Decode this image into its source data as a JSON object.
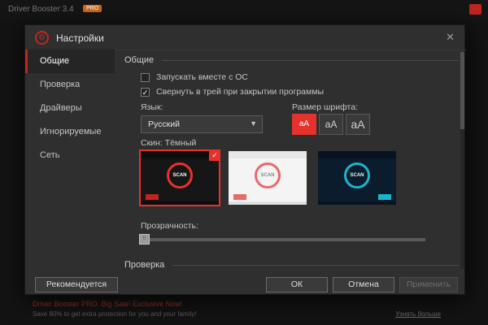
{
  "window": {
    "title": "Driver Booster 3.4",
    "badge": "PRO"
  },
  "background_promo": {
    "line1": "Driver Booster PRO: Big Sale! Exclusive Now!",
    "line2": "Save 80% to get extra protection for you and your family!",
    "link": "Узнать больше"
  },
  "icons": {
    "gear": "⚙",
    "close": "✕",
    "check": "✓",
    "dropdown": "▼",
    "handle": "⠿"
  },
  "dialog": {
    "title": "Настройки",
    "sidebar": [
      {
        "label": "Общие",
        "active": true
      },
      {
        "label": "Проверка",
        "active": false
      },
      {
        "label": "Драйверы",
        "active": false
      },
      {
        "label": "Игнорируемые",
        "active": false
      },
      {
        "label": "Сеть",
        "active": false
      }
    ],
    "section_general": "Общие",
    "section_scan": "Проверка",
    "checkboxes": [
      {
        "label": "Запускать вместе с ОС",
        "checked": false
      },
      {
        "label": "Свернуть в трей при закрытии программы",
        "checked": true
      }
    ],
    "language_label": "Язык:",
    "language_value": "Русский",
    "font_size_label": "Размер шрифта:",
    "font_sizes": [
      "аА",
      "аА",
      "аА"
    ],
    "font_size_selected": 0,
    "skin_label": "Скин: Тёмный",
    "skins": [
      {
        "name": "dark",
        "scan": "SCAN",
        "selected": true
      },
      {
        "name": "light",
        "scan": "SCAN",
        "selected": false
      },
      {
        "name": "navy",
        "scan": "SCAN",
        "selected": false
      }
    ],
    "transparency_label": "Прозрачность:",
    "buttons": {
      "recommended": "Рекомендуется",
      "ok": "ОК",
      "cancel": "Отмена",
      "apply": "Применить"
    }
  },
  "colors": {
    "accent": "#e5322d",
    "teal": "#19b6c9"
  }
}
